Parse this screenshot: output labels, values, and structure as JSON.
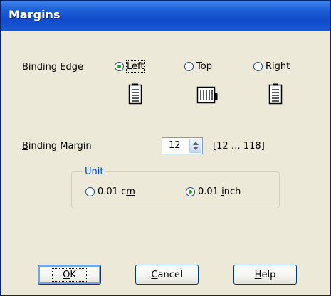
{
  "window": {
    "title": "Margins"
  },
  "binding_edge": {
    "label": "Binding Edge",
    "options": [
      {
        "pre": "",
        "ul": "L",
        "post": "eft",
        "checked": true
      },
      {
        "pre": "",
        "ul": "T",
        "post": "op",
        "checked": false
      },
      {
        "pre": "",
        "ul": "R",
        "post": "ight",
        "checked": false
      }
    ],
    "icons": [
      "binding-left-document-icon",
      "binding-top-document-icon",
      "binding-right-document-icon"
    ]
  },
  "binding_margin": {
    "label_ul": "B",
    "label_rest": "inding Margin",
    "value": "12",
    "range": "[12 … 118]"
  },
  "unit": {
    "legend": "Unit",
    "options": [
      {
        "pre": "0.01 c",
        "ul": "m",
        "post": "",
        "checked": false
      },
      {
        "pre": "0.01 ",
        "ul": "i",
        "post": "nch",
        "checked": true
      }
    ]
  },
  "buttons": {
    "ok": {
      "pre": "",
      "ul": "O",
      "post": "K"
    },
    "cancel": {
      "pre": "",
      "ul": "C",
      "post": "ancel"
    },
    "help": {
      "pre": "",
      "ul": "H",
      "post": "elp"
    }
  },
  "colors": {
    "title_bar": "#1e5fd6",
    "dialog_bg": "#ece9d8",
    "radio_dot": "#21a121",
    "group_legend": "#0046d5"
  }
}
